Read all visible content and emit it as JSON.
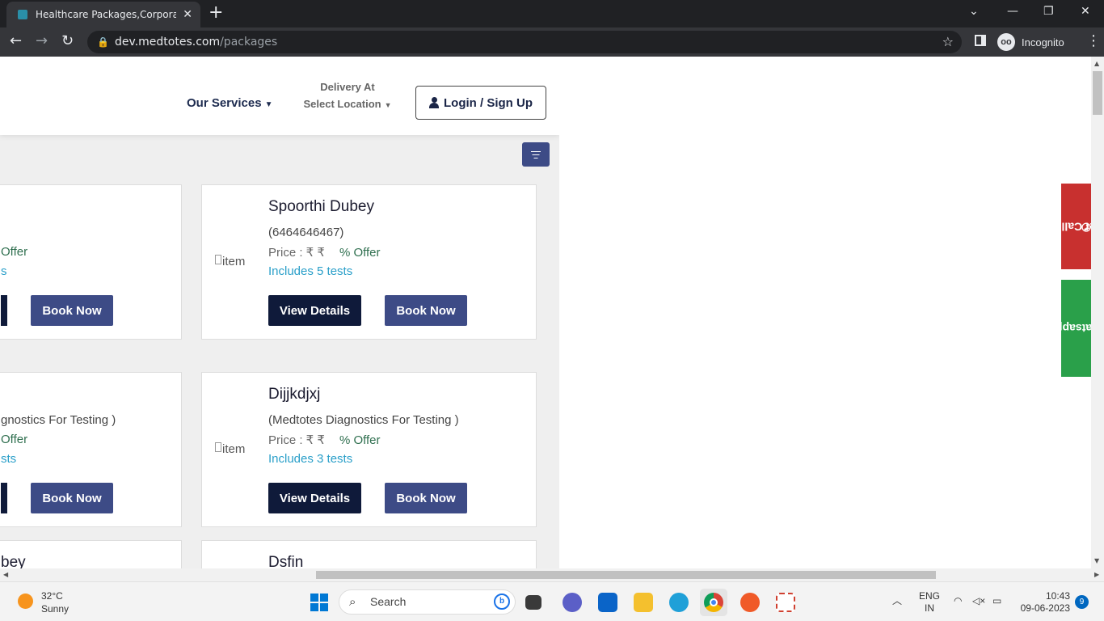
{
  "browser": {
    "tab_title": "Healthcare Packages,Corporate H",
    "url_host": "dev.medtotes.com",
    "url_path": "/packages",
    "profile_label": "Incognito"
  },
  "header": {
    "services_label": "Our Services",
    "delivery_label": "Delivery At",
    "location_label": "Select Location",
    "login_label": "Login / Sign Up"
  },
  "cards": [
    {
      "name": "Spoorthi Dubey",
      "sub": "(6464646467)",
      "price": "Price : ₹ ₹",
      "offer": "% Offer",
      "includes": "Includes 5 tests",
      "img_alt": "item",
      "view_label": "View Details",
      "book_label": "Book Now"
    },
    {
      "name": "Dijjkdjxj",
      "sub": "(Medtotes Diagnostics For Testing )",
      "price": "Price : ₹ ₹",
      "offer": "% Offer",
      "includes": "Includes 3 tests",
      "img_alt": "item",
      "view_label": "View Details",
      "book_label": "Book Now"
    },
    {
      "name": "Dsfin"
    }
  ],
  "left_fragments": {
    "r1_offer": "Offer",
    "r1_inc": "s",
    "r1_book": "Book Now",
    "r2_sub": "gnostics For Testing )",
    "r2_offer": "Offer",
    "r2_inc": "sts",
    "r2_book": "Book Now",
    "r3_name": "bey"
  },
  "side_buttons": {
    "get_call": "Get Call",
    "whatsapp": "Whatsapp"
  },
  "taskbar": {
    "temp": "32°C",
    "condition": "Sunny",
    "search_placeholder": "Search",
    "lang_1": "ENG",
    "lang_2": "IN",
    "time": "10:43",
    "date": "09-06-2023",
    "notif_count": "9"
  },
  "colors": {
    "brand_navy": "#0f1a3a",
    "brand_blue": "#3d4b86",
    "offer_green": "#2f6f4f",
    "link_blue": "#2a9fc9",
    "get_call_red": "#c8302f",
    "whatsapp_green": "#2aa04a"
  }
}
